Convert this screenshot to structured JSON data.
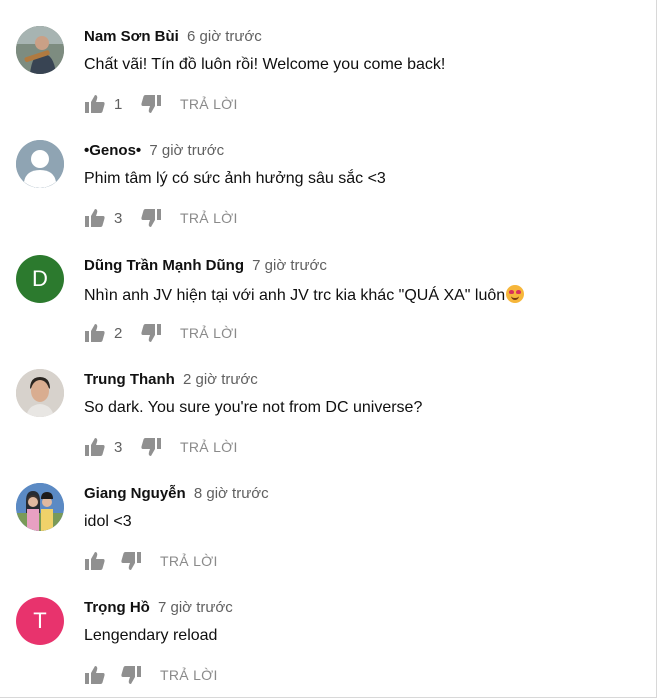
{
  "reply_label": "TRẢ LỜI",
  "colors": {
    "avatar_d": "#2c7a2e",
    "avatar_t": "#e8336d",
    "avatar_default": "#8fa4b3"
  },
  "comments": [
    {
      "author": "Nam Sơn Bùi",
      "time": "6 giờ trước",
      "text": "Chất vãi! Tín đồ luôn rồi! Welcome you come back!",
      "likes": "1",
      "avatar": "photo-guitar"
    },
    {
      "author": "•Genos•",
      "time": "7 giờ trước",
      "text": "Phim tâm lý có sức ảnh hưởng sâu sắc <3",
      "likes": "3",
      "avatar": "default-person-icon"
    },
    {
      "author": "Dũng Trần Mạnh Dũng",
      "time": "7 giờ trước",
      "text": "Nhìn anh JV hiện tại với anh JV trc kia khác \"QUÁ XA\" luôn",
      "likes": "2",
      "avatar_letter": "D",
      "emoji": "smiling-face-with-heart-eyes"
    },
    {
      "author": "Trung Thanh",
      "time": "2 giờ trước",
      "text": "So dark. You sure you're not from DC universe?",
      "likes": "3",
      "avatar": "photo-portrait"
    },
    {
      "author": "Giang Nguyễn",
      "time": "8 giờ trước",
      "text": "idol <3",
      "likes": "",
      "avatar": "photo-two-people"
    },
    {
      "author": "Trọng Hồ",
      "time": "7 giờ trước",
      "text": "Lengendary reload",
      "likes": "",
      "avatar_letter": "T"
    }
  ]
}
